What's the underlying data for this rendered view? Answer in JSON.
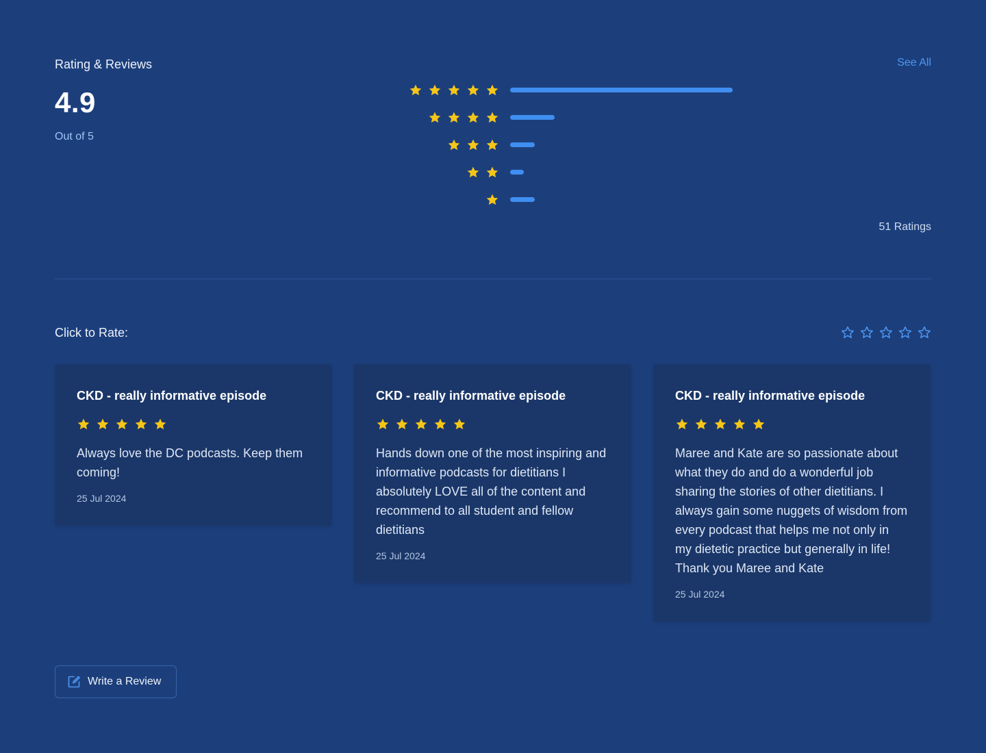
{
  "header": {
    "title": "Rating & Reviews",
    "see_all": "See All"
  },
  "summary": {
    "score": "4.9",
    "out_of": "Out of 5",
    "ratings_count": "51 Ratings"
  },
  "distribution": [
    {
      "stars": 5,
      "fraction": 1.0
    },
    {
      "stars": 4,
      "fraction": 0.2
    },
    {
      "stars": 3,
      "fraction": 0.11
    },
    {
      "stars": 2,
      "fraction": 0.06
    },
    {
      "stars": 1,
      "fraction": 0.11
    }
  ],
  "rate": {
    "label": "Click to Rate:",
    "star_count": 5
  },
  "reviews": [
    {
      "title": "CKD - really informative episode",
      "stars": 5,
      "text": "Always love the DC podcasts. Keep them coming!",
      "date": "25 Jul 2024"
    },
    {
      "title": "CKD - really informative episode",
      "stars": 5,
      "text": "Hands down one of the most inspiring and informative podcasts for dietitians I absolutely LOVE all of the content and recommend to all student and fellow dietitians",
      "date": "25 Jul 2024"
    },
    {
      "title": "CKD - really informative episode",
      "stars": 5,
      "text": "Maree and Kate are so passionate about what they do and do a wonderful job sharing the stories of other dietitians. I always gain some nuggets of wisdom from every podcast that helps me not only in my dietetic practice but generally in life! Thank you Maree and Kate",
      "date": "25 Jul 2024"
    }
  ],
  "actions": {
    "write_review": "Write a Review"
  },
  "colors": {
    "background": "#1c3f7c",
    "card": "#1b3769",
    "star_filled": "#f5c518",
    "bar": "#3f8ef0",
    "link": "#4e97f2"
  },
  "icons": {
    "filled_star": "star-icon",
    "outline_star": "star-outline-icon",
    "write": "edit-icon"
  }
}
